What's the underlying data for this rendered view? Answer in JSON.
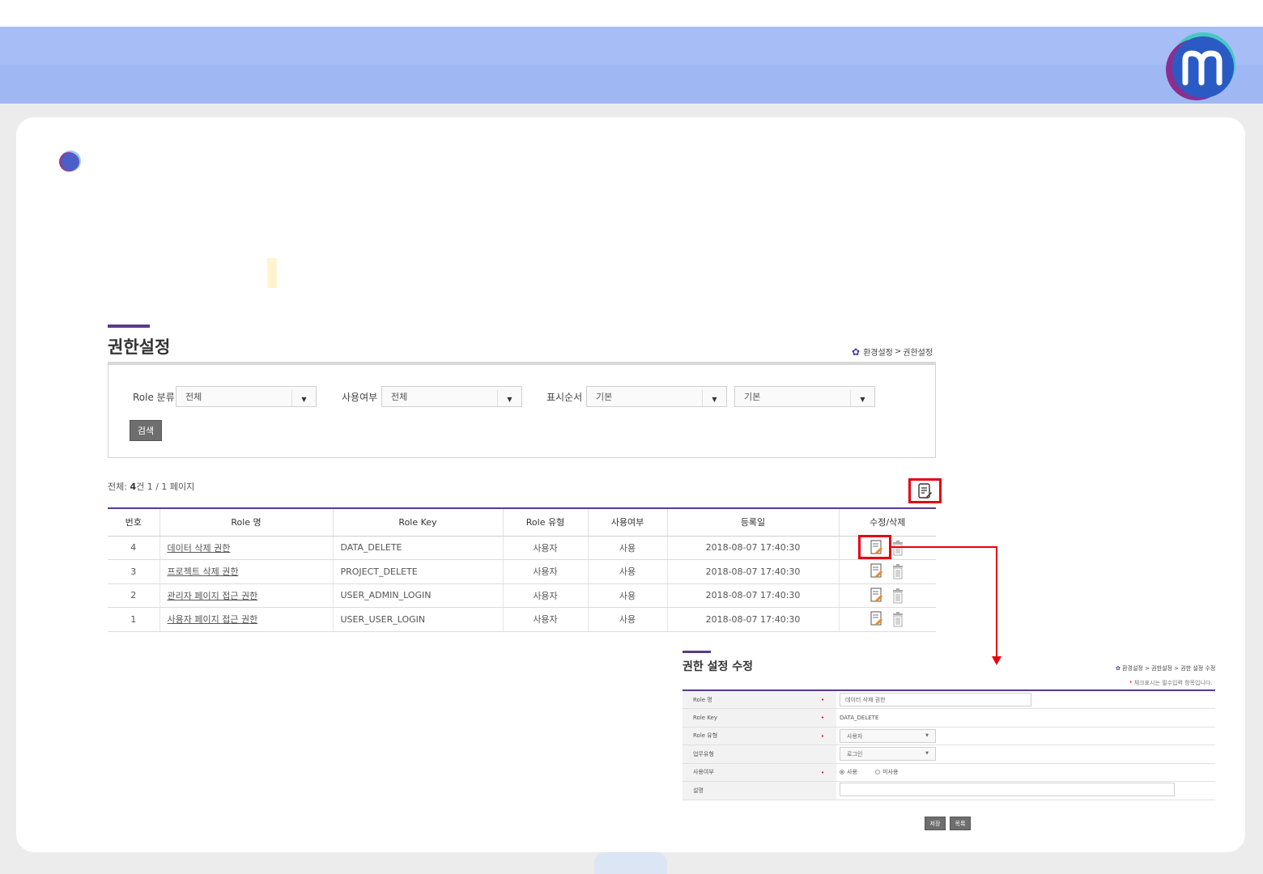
{
  "page": {
    "title": "권한설정",
    "breadcrumb": [
      "환경설정",
      "권한설정"
    ]
  },
  "filters": [
    {
      "label": "Role 분류",
      "value": "전체"
    },
    {
      "label": "사용여부",
      "value": "전체"
    },
    {
      "label": "표시순서",
      "value": "기본"
    },
    {
      "label": "",
      "value": "기본"
    }
  ],
  "search_button": "검색",
  "summary": {
    "prefix": "전체: ",
    "count": "4",
    "suffix": "건 1 / 1 페이지"
  },
  "table": {
    "headers": [
      "번호",
      "Role 명",
      "Role Key",
      "Role 유형",
      "사용여부",
      "등록일",
      "수정/삭제"
    ],
    "rows": [
      {
        "no": "4",
        "name": "데이터 삭제 권한",
        "key": "DATA_DELETE",
        "type": "사용자",
        "use": "사용",
        "date": "2018-08-07 17:40:30"
      },
      {
        "no": "3",
        "name": "프로젝트 삭제 권한",
        "key": "PROJECT_DELETE",
        "type": "사용자",
        "use": "사용",
        "date": "2018-08-07 17:40:30"
      },
      {
        "no": "2",
        "name": "관리자 페이지 접근 권한",
        "key": "USER_ADMIN_LOGIN",
        "type": "사용자",
        "use": "사용",
        "date": "2018-08-07 17:40:30"
      },
      {
        "no": "1",
        "name": "사용자 페이지 접근 권한",
        "key": "USER_USER_LOGIN",
        "type": "사용자",
        "use": "사용",
        "date": "2018-08-07 17:40:30"
      }
    ]
  },
  "edit_form": {
    "title": "권한 설정 수정",
    "breadcrumb": "환경설정 > 권한설정 > 권한 설정 수정",
    "note_star": "*",
    "note": " 체크표시는 필수입력 항목입니다.",
    "fields": {
      "role_name_label": "Role 명",
      "role_name_value": "데이터 삭제 권한",
      "role_key_label": "Role Key",
      "role_key_value": "DATA_DELETE",
      "role_type_label": "Role 유형",
      "role_type_value": "사용자",
      "biz_type_label": "업무유형",
      "biz_type_value": "로그인",
      "use_label": "사용여부",
      "use_yes": "사용",
      "use_no": "미사용",
      "desc_label": "설명"
    },
    "save_button": "저장",
    "list_button": "목록"
  },
  "colors": {
    "header_band": "#a6bdf6",
    "accent_purple": "#5b3a8a",
    "highlight_red": "#e60012"
  }
}
